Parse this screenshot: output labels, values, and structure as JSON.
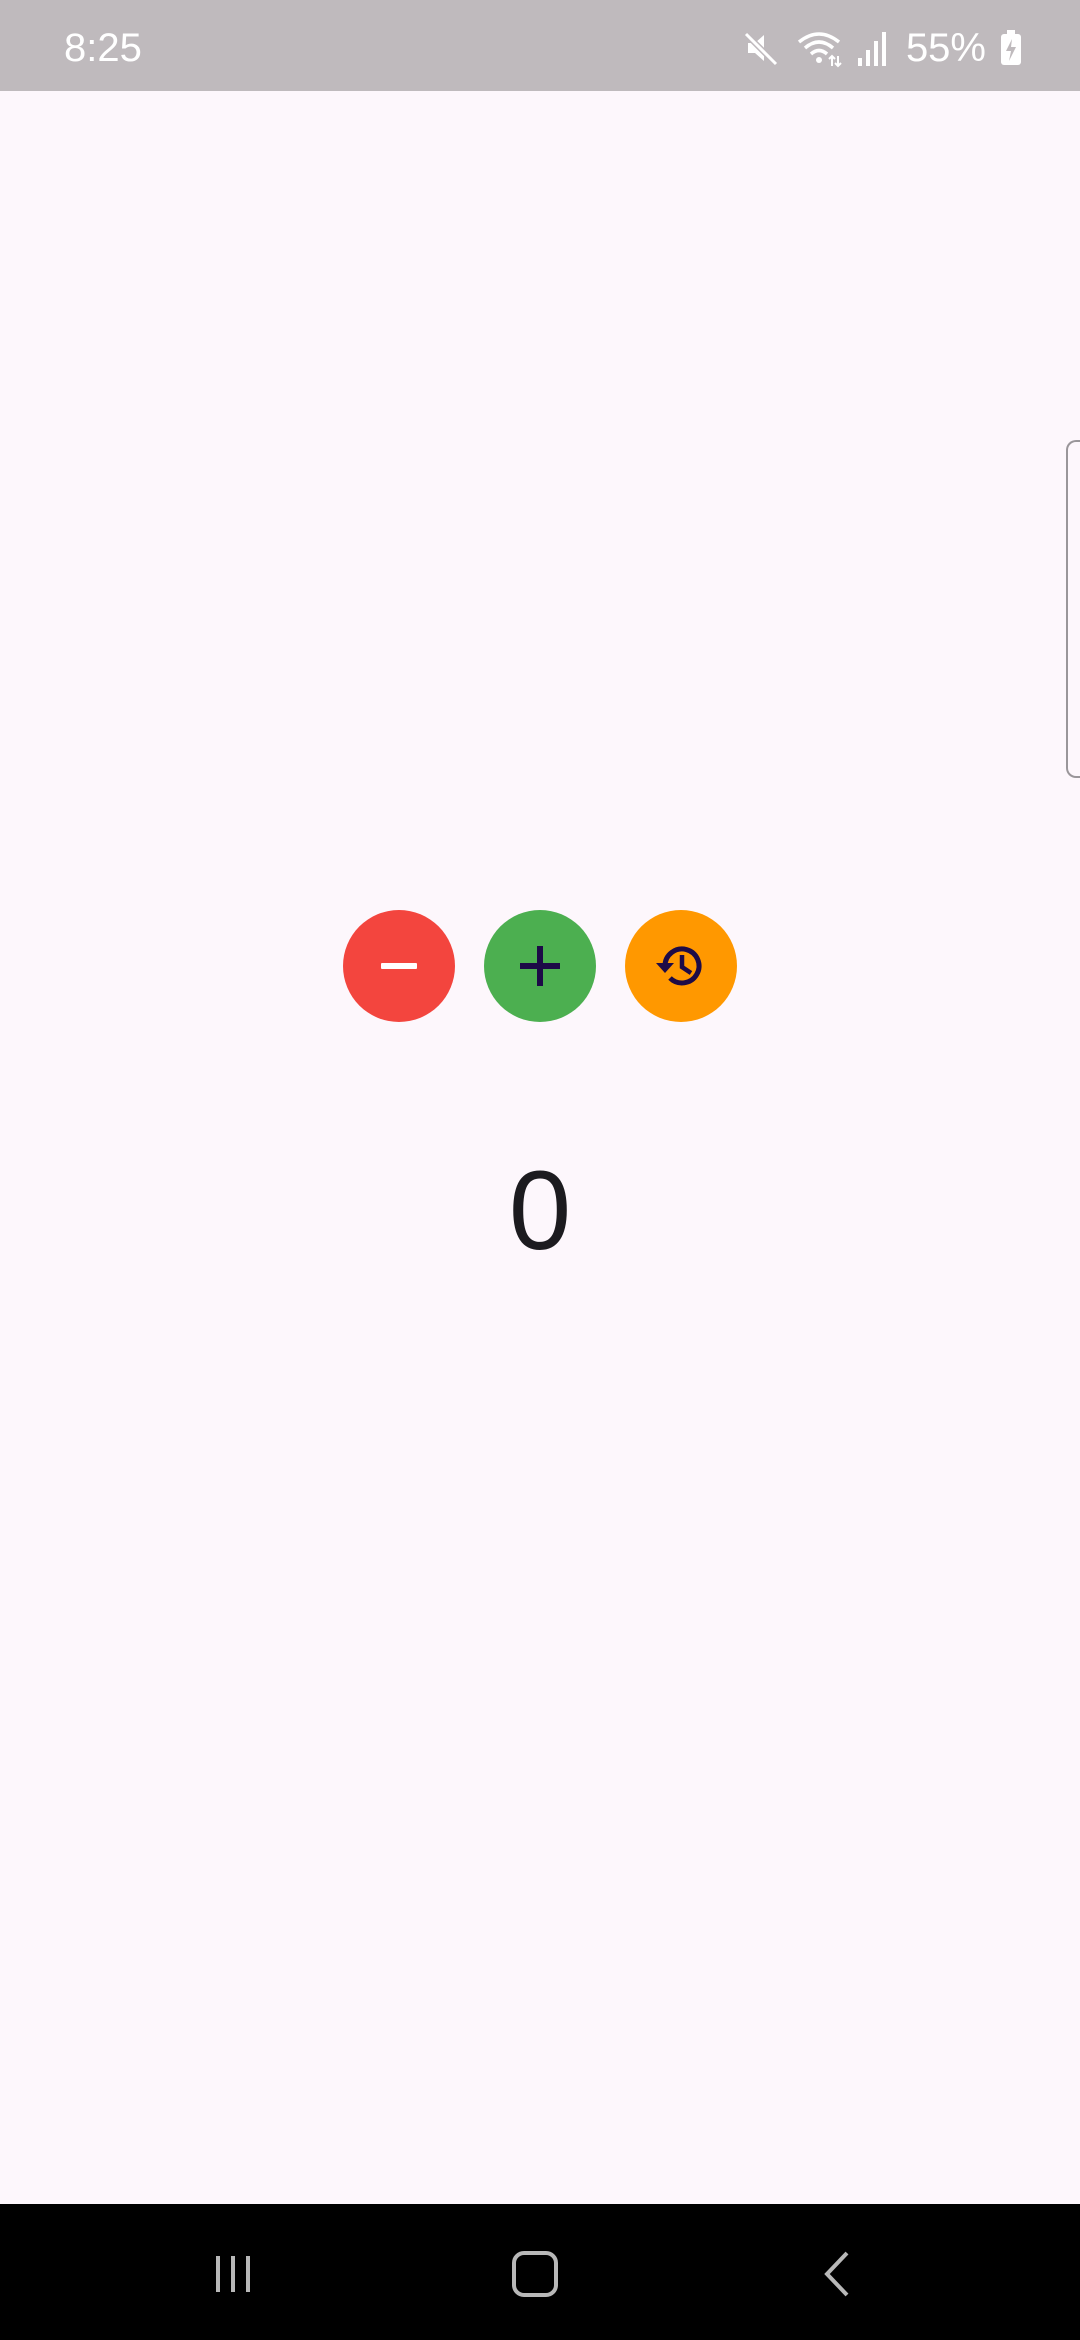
{
  "status_bar": {
    "time": "8:25",
    "battery_percent": "55%",
    "icons": [
      "mute-icon",
      "wifi-icon",
      "signal-icon",
      "battery-charging-icon"
    ]
  },
  "counter": {
    "value": "0",
    "buttons": [
      {
        "name": "decrement",
        "icon": "minus-icon",
        "color": "#f3453e"
      },
      {
        "name": "increment",
        "icon": "plus-icon",
        "color": "#4caf50"
      },
      {
        "name": "reset",
        "icon": "history-icon",
        "color": "#ff9800"
      }
    ]
  },
  "navigation_bar": {
    "buttons": [
      "recents-icon",
      "home-icon",
      "back-icon"
    ]
  },
  "colors": {
    "background": "#fdf7fc",
    "status_bar": "#bfbabd",
    "icon_dark": "#1d0b47",
    "text": "#1c1b1f"
  }
}
